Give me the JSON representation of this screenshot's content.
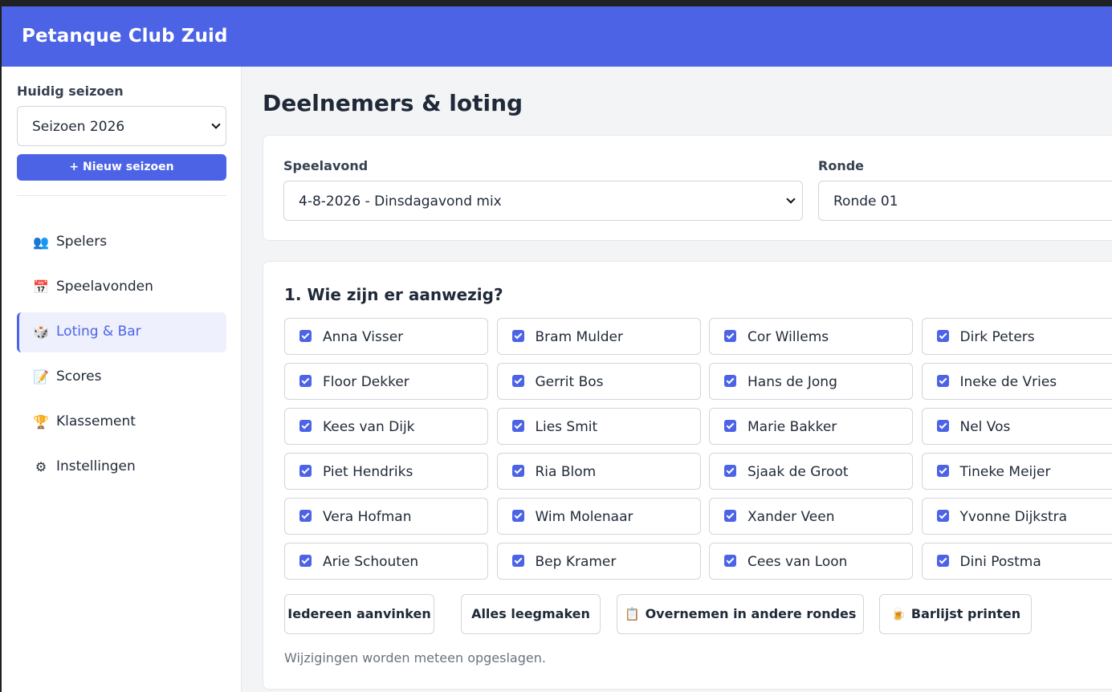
{
  "app": {
    "title": "Petanque Club Zuid"
  },
  "sidebar": {
    "season_label": "Huidig seizoen",
    "season_value": "Seizoen 2026",
    "new_season_label": "+ Nieuw seizoen",
    "items": [
      {
        "label": "Spelers",
        "icon": "people-icon",
        "glyph": "👥"
      },
      {
        "label": "Speelavonden",
        "icon": "calendar-icon",
        "glyph": "📅"
      },
      {
        "label": "Loting & Bar",
        "icon": "dice-icon",
        "glyph": "🎲",
        "active": true
      },
      {
        "label": "Scores",
        "icon": "memo-icon",
        "glyph": "📝"
      },
      {
        "label": "Klassement",
        "icon": "trophy-icon",
        "glyph": "🏆"
      },
      {
        "label": "Instellingen",
        "icon": "gear-icon",
        "glyph": "⚙"
      }
    ]
  },
  "main": {
    "title": "Deelnemers & loting",
    "speelavond": {
      "label": "Speelavond",
      "value": "4-8-2026 - Dinsdagavond mix"
    },
    "ronde": {
      "label": "Ronde",
      "value": "Ronde 01"
    },
    "attendance": {
      "title": "1. Wie zijn er aanwezig?",
      "players": [
        {
          "name": "Anna Visser",
          "checked": true
        },
        {
          "name": "Bram Mulder",
          "checked": true
        },
        {
          "name": "Cor Willems",
          "checked": true
        },
        {
          "name": "Dirk Peters",
          "checked": true
        },
        {
          "name": "Floor Dekker",
          "checked": true
        },
        {
          "name": "Gerrit Bos",
          "checked": true
        },
        {
          "name": "Hans de Jong",
          "checked": true
        },
        {
          "name": "Ineke de Vries",
          "checked": true
        },
        {
          "name": "Kees van Dijk",
          "checked": true
        },
        {
          "name": "Lies Smit",
          "checked": true
        },
        {
          "name": "Marie Bakker",
          "checked": true
        },
        {
          "name": "Nel Vos",
          "checked": true
        },
        {
          "name": "Piet Hendriks",
          "checked": true
        },
        {
          "name": "Ria Blom",
          "checked": true
        },
        {
          "name": "Sjaak de Groot",
          "checked": true
        },
        {
          "name": "Tineke Meijer",
          "checked": true
        },
        {
          "name": "Vera Hofman",
          "checked": true
        },
        {
          "name": "Wim Molenaar",
          "checked": true
        },
        {
          "name": "Xander Veen",
          "checked": true
        },
        {
          "name": "Yvonne Dijkstra",
          "checked": true
        },
        {
          "name": "Arie Schouten",
          "checked": true
        },
        {
          "name": "Bep Kramer",
          "checked": true
        },
        {
          "name": "Cees van Loon",
          "checked": true
        },
        {
          "name": "Dini Postma",
          "checked": true
        }
      ],
      "buttons": [
        {
          "label": "Iedereen aanvinken",
          "icon": ""
        },
        {
          "label": "Alles leegmaken",
          "icon": ""
        },
        {
          "label": "Overnemen in andere rondes",
          "icon": "clipboard-icon",
          "glyph": "📋"
        },
        {
          "label": "Barlijst printen",
          "icon": "beer-icon",
          "glyph": "🍺"
        }
      ],
      "note": "Wijzigingen worden meteen opgeslagen."
    }
  }
}
